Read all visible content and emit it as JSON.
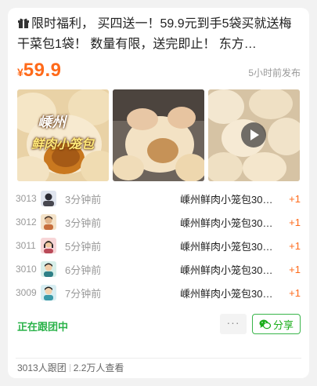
{
  "post": {
    "title": "限时福利， 买四送一！59.9元到手5袋买就送梅干菜包1袋！ 数量有限，送完即止！ 东方…",
    "currency": "¥",
    "price": "59.9",
    "posted_time": "5小时前发布"
  },
  "images": {
    "caption_top": "嵊州",
    "caption_bottom": "鲜肉小笼包"
  },
  "orders": [
    {
      "idx": "3013",
      "time": "3分钟前",
      "product": "嵊州鲜肉小笼包30…",
      "qty": "+1"
    },
    {
      "idx": "3012",
      "time": "3分钟前",
      "product": "嵊州鲜肉小笼包30…",
      "qty": "+1"
    },
    {
      "idx": "3011",
      "time": "5分钟前",
      "product": "嵊州鲜肉小笼包30…",
      "qty": "+1"
    },
    {
      "idx": "3010",
      "time": "6分钟前",
      "product": "嵊州鲜肉小笼包30…",
      "qty": "+1"
    },
    {
      "idx": "3009",
      "time": "7分钟前",
      "product": "嵊州鲜肉小笼包30…",
      "qty": "+1"
    }
  ],
  "actions": {
    "status": "正在跟团中",
    "more_label": "···",
    "share_label": "分享"
  },
  "footer": {
    "followers": "3013人跟团",
    "views": "2.2万人查看"
  },
  "colors": {
    "accent": "#ff6a1a",
    "status_green": "#2bb34a",
    "share_green": "#1aad19"
  },
  "icons": {
    "title": "gift-icon",
    "share": "wechat-icon",
    "video": "play-icon"
  }
}
